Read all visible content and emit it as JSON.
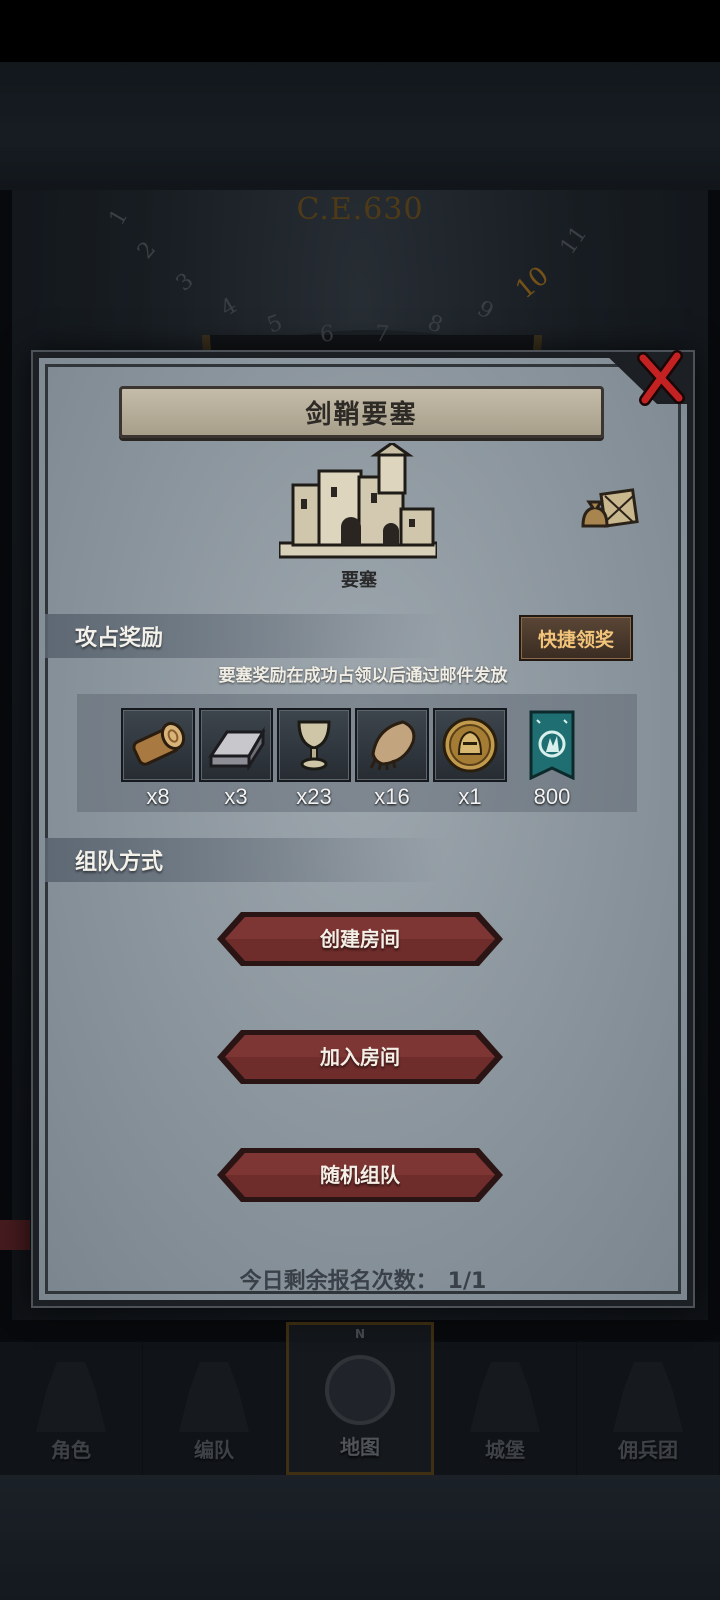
{
  "background": {
    "era_label": "C.E.630",
    "dial_numbers": [
      "1",
      "2",
      "3",
      "4",
      "5",
      "6",
      "7",
      "8",
      "9",
      "10",
      "11"
    ],
    "dial_highlight": "10"
  },
  "modal": {
    "title": "剑鞘要塞",
    "building_label": "要塞",
    "reward_section": {
      "title": "攻占奖励",
      "quick_claim_label": "快捷领奖",
      "note": "要塞奖励在成功占领以后通过邮件发放",
      "items": [
        {
          "icon": "log-wood-icon",
          "qty": "x8"
        },
        {
          "icon": "iron-ingot-icon",
          "qty": "x3"
        },
        {
          "icon": "goblet-icon",
          "qty": "x23"
        },
        {
          "icon": "fur-pelt-icon",
          "qty": "x16"
        },
        {
          "icon": "knight-coin-icon",
          "qty": "x1"
        },
        {
          "icon": "guild-banner-icon",
          "qty": "800"
        }
      ]
    },
    "team_section": {
      "title": "组队方式",
      "buttons": [
        "创建房间",
        "加入房间",
        "随机组队"
      ]
    },
    "remaining": {
      "label": "今日剩余报名次数：",
      "value": "1/1"
    }
  },
  "bottom_nav": {
    "north_marker": "N",
    "items": [
      "角色",
      "编队",
      "地图",
      "城堡",
      "佣兵团"
    ],
    "active": "地图"
  },
  "colors": {
    "panel": "#8a949c",
    "button_red": "#6e2c2a",
    "accent_gold": "#f2c47a",
    "close_red": "#c42222"
  }
}
